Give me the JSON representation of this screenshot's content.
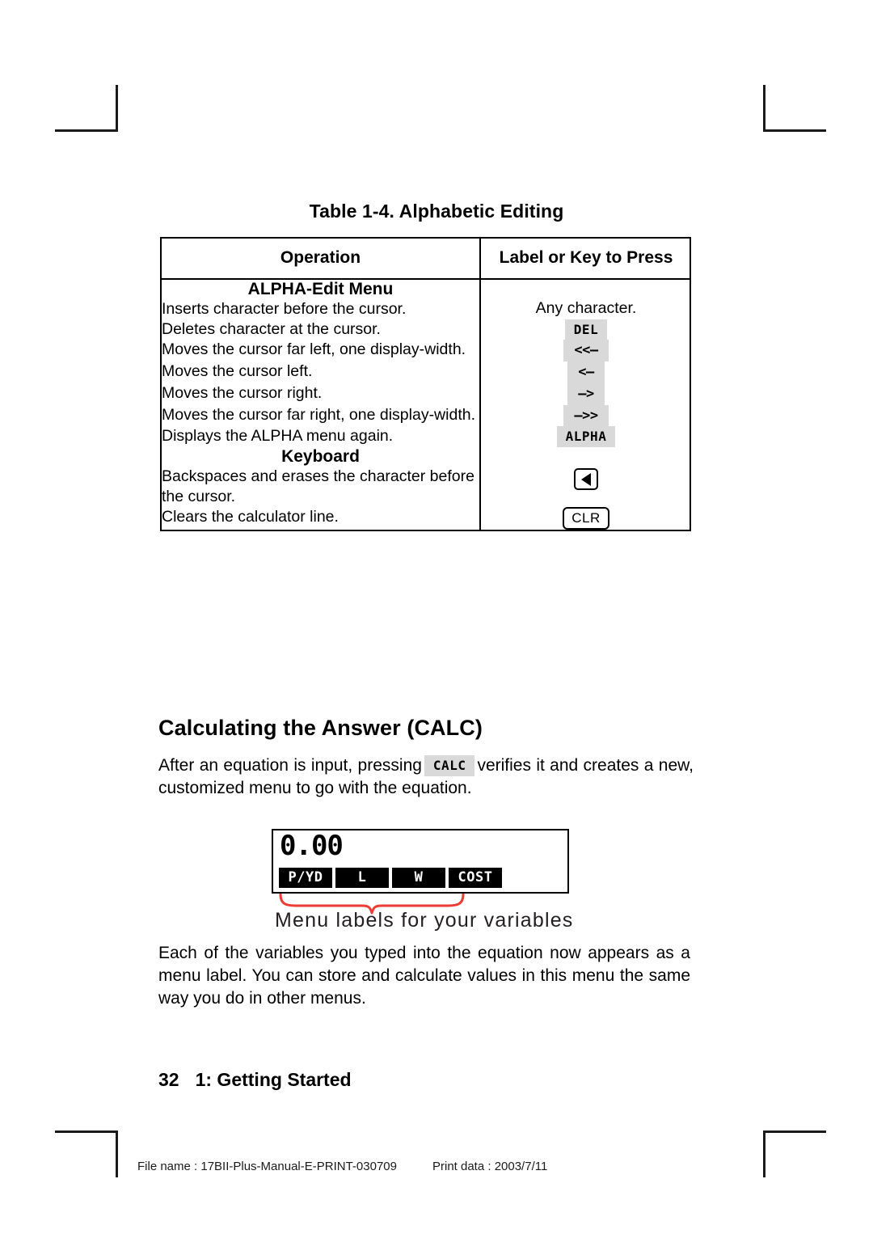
{
  "table": {
    "title": "Table 1-4. Alphabetic Editing",
    "headers": [
      "Operation",
      "Label or Key to Press"
    ],
    "sections": [
      {
        "name": "ALPHA-Edit Menu",
        "rows": [
          {
            "operation": "Inserts character before the cursor.",
            "key": "Any character.",
            "key_kind": "text"
          },
          {
            "operation": "Deletes character at the cursor.",
            "key": "DEL",
            "key_kind": "chip"
          },
          {
            "operation": "Moves the cursor far left, one display-width.",
            "key": "<<—",
            "key_kind": "chip-arrow"
          },
          {
            "operation": "Moves the cursor left.",
            "key": "<—",
            "key_kind": "chip-arrow"
          },
          {
            "operation": "Moves the cursor right.",
            "key": "—>",
            "key_kind": "chip-arrow"
          },
          {
            "operation": "Moves the cursor far right, one display-width.",
            "key": "—>>",
            "key_kind": "chip-arrow"
          },
          {
            "operation": "Displays the ALPHA menu again.",
            "key": "ALPHA",
            "key_kind": "chip"
          }
        ]
      },
      {
        "name": "Keyboard",
        "rows": [
          {
            "operation": "Backspaces and erases the character before the cursor.",
            "key": "backspace-arrow",
            "key_kind": "pkey-backspace"
          },
          {
            "operation": "Clears the calculator line.",
            "key": "CLR",
            "key_kind": "pkey"
          }
        ]
      }
    ]
  },
  "section": {
    "heading": "Calculating the Answer (CALC)",
    "para1_before": "After an equation is input, pressing",
    "para1_key": "CALC",
    "para1_after": "verifies it and creates a new, customized menu to go with the equation.",
    "para2": "Each of the variables you typed into the equation now appears as a menu label. You can store and calculate values in this menu the same way you do in other menus."
  },
  "figure": {
    "display_value": "0.00",
    "menu_labels": [
      "P/YD",
      "L",
      "W",
      "COST"
    ],
    "caption": "Menu labels for your variables",
    "brace_color": "#ee3b33"
  },
  "footer": {
    "page_number": "32",
    "chapter": "1: Getting Started",
    "file_name": "File name : 17BII-Plus-Manual-E-PRINT-030709",
    "print_date": "Print data : 2003/7/11"
  }
}
